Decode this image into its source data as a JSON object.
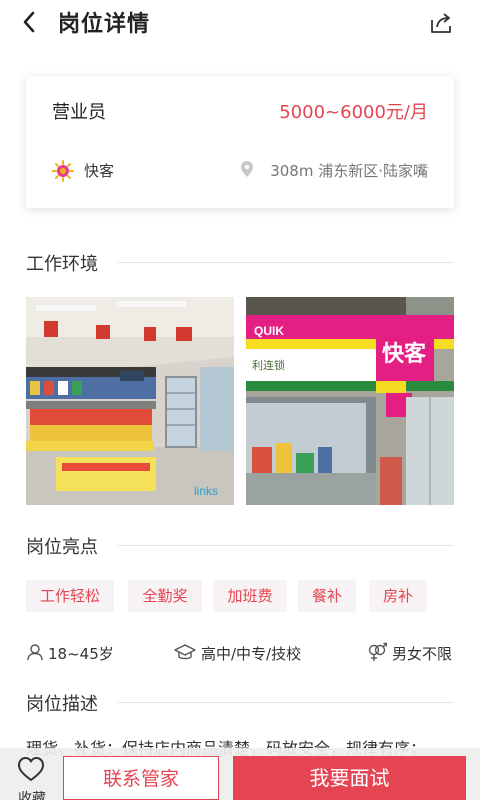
{
  "header": {
    "title": "岗位详情"
  },
  "job": {
    "title": "营业员",
    "salary": "5000~6000元/月",
    "company": "快客",
    "location": "308m  浦东新区·陆家嘴"
  },
  "sections": {
    "environment": "工作环境",
    "highlights": "岗位亮点",
    "description": "岗位描述"
  },
  "photos": {
    "store_sign": "快客",
    "quik": "QUIK",
    "chain": "利连锁",
    "watermark": "links"
  },
  "tags": [
    "工作轻松",
    "全勤奖",
    "加班费",
    "餐补",
    "房补"
  ],
  "requirements": {
    "age": "18~45岁",
    "education": "高中/中专/技校",
    "gender": "男女不限"
  },
  "description_text": "理货、补货：保持店内商品清楚，码放安全，规律有序；",
  "bottom": {
    "favorite": "收藏",
    "contact": "联系管家",
    "apply": "我要面试"
  },
  "colors": {
    "accent": "#e54552",
    "tag_bg": "#f7f2f3"
  }
}
